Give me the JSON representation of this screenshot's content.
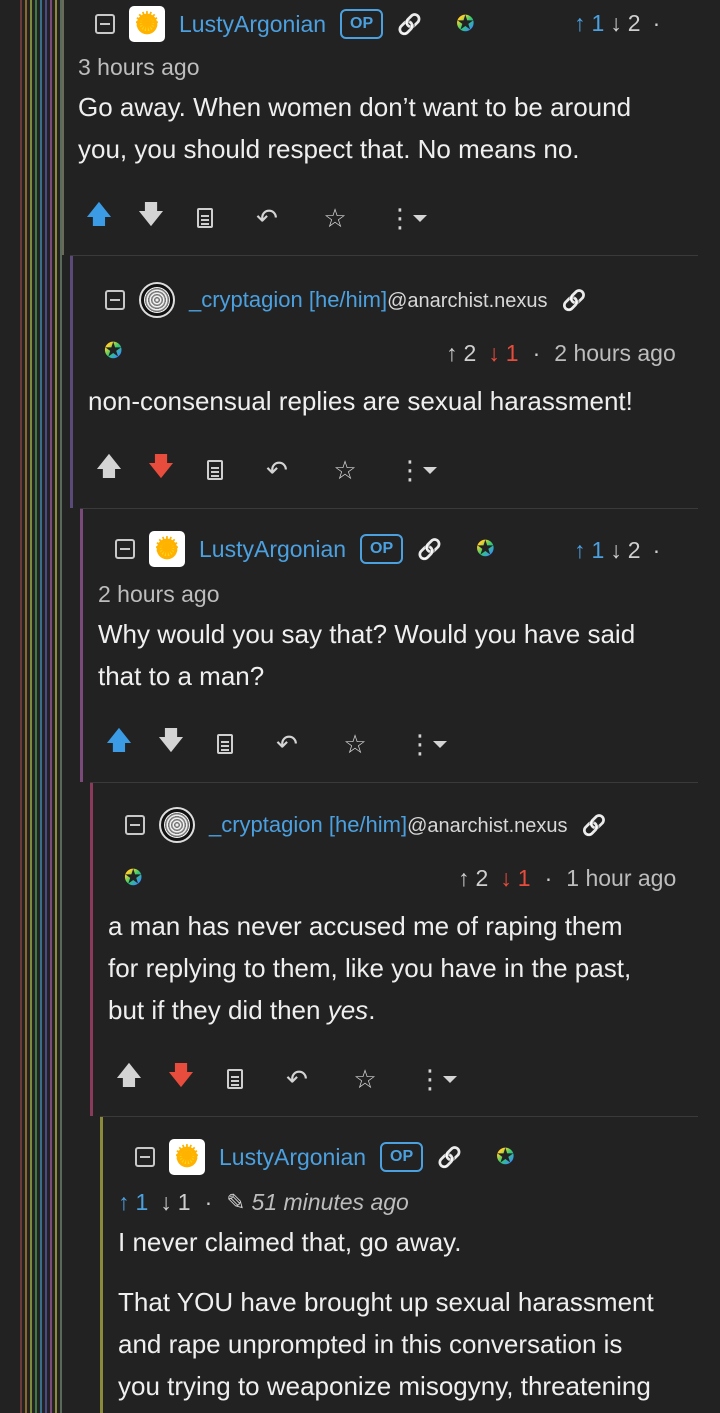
{
  "thread_colors": [
    "#7a4a4a",
    "#8a6a3a",
    "#7f8a3a",
    "#3d8a4a",
    "#3a6f8a",
    "#5a4a8a",
    "#7a4a7a",
    "#6a4a8a",
    "#8a3a5a",
    "#8a8a3a"
  ],
  "comments": [
    {
      "username": "LustyArgonian",
      "instance": "",
      "op_badge": "OP",
      "upvotes": "1",
      "downvotes": "2",
      "separator": "·",
      "time": "3 hours ago",
      "body": [
        "Go away. When women don’t want to be around",
        "you, you should respect that. No means no."
      ],
      "vote_state": "up",
      "accent": "#4ba0e0"
    },
    {
      "username": "_cryptagion [he/him]",
      "instance": "@anarchist.nexus",
      "op_badge": "",
      "upvotes": "2",
      "downvotes": "1",
      "separator": "·",
      "time": "2 hours ago",
      "body": [
        "non-consensual replies are sexual harassment!"
      ],
      "vote_state": "down",
      "accent": "#e74c3c"
    },
    {
      "username": "LustyArgonian",
      "instance": "",
      "op_badge": "OP",
      "upvotes": "1",
      "downvotes": "2",
      "separator": "·",
      "time": "2 hours ago",
      "body": [
        "Why would you say that? Would you have said",
        "that to a man?"
      ],
      "vote_state": "up"
    },
    {
      "username": "_cryptagion [he/him]",
      "instance": "@anarchist.nexus",
      "op_badge": "",
      "upvotes": "2",
      "downvotes": "1",
      "separator": "·",
      "time": "1 hour ago",
      "body_lines": [
        "a man has never accused me of raping them",
        "for replying to them, like you have in the past,"
      ],
      "body_last_prefix": "but if they did then ",
      "body_last_emph": "yes",
      "body_last_suffix": ".",
      "vote_state": "down"
    },
    {
      "username": "LustyArgonian",
      "instance": "",
      "op_badge": "OP",
      "upvotes": "1",
      "downvotes": "1",
      "separator": "·",
      "edited_icon": "pencil-icon",
      "time": "51 minutes ago",
      "body": [
        "I never claimed that, go away."
      ],
      "body2": [
        "That YOU have brought up sexual harassment",
        "and rape unprompted in this conversation is",
        "you trying to weaponize misogyny, threatening"
      ]
    }
  ],
  "icons": {
    "collapse": "collapse-icon",
    "link": "link-icon",
    "badge": "rainbow-star-icon",
    "upvote": "arrow-up-icon",
    "downvote": "arrow-down-icon",
    "source": "document-icon",
    "reply": "reply-icon",
    "save": "star-icon",
    "more": "more-vertical-icon",
    "dropdown": "caret-down-icon"
  },
  "glyphs": {
    "up_arrow": "↑",
    "down_arrow": "↓",
    "link": "🔗",
    "badge": "✪",
    "action_up": "🡅",
    "action_down": "🡇",
    "reply": "↶",
    "save": "☆",
    "more": "⋮",
    "pencil": "✎"
  }
}
